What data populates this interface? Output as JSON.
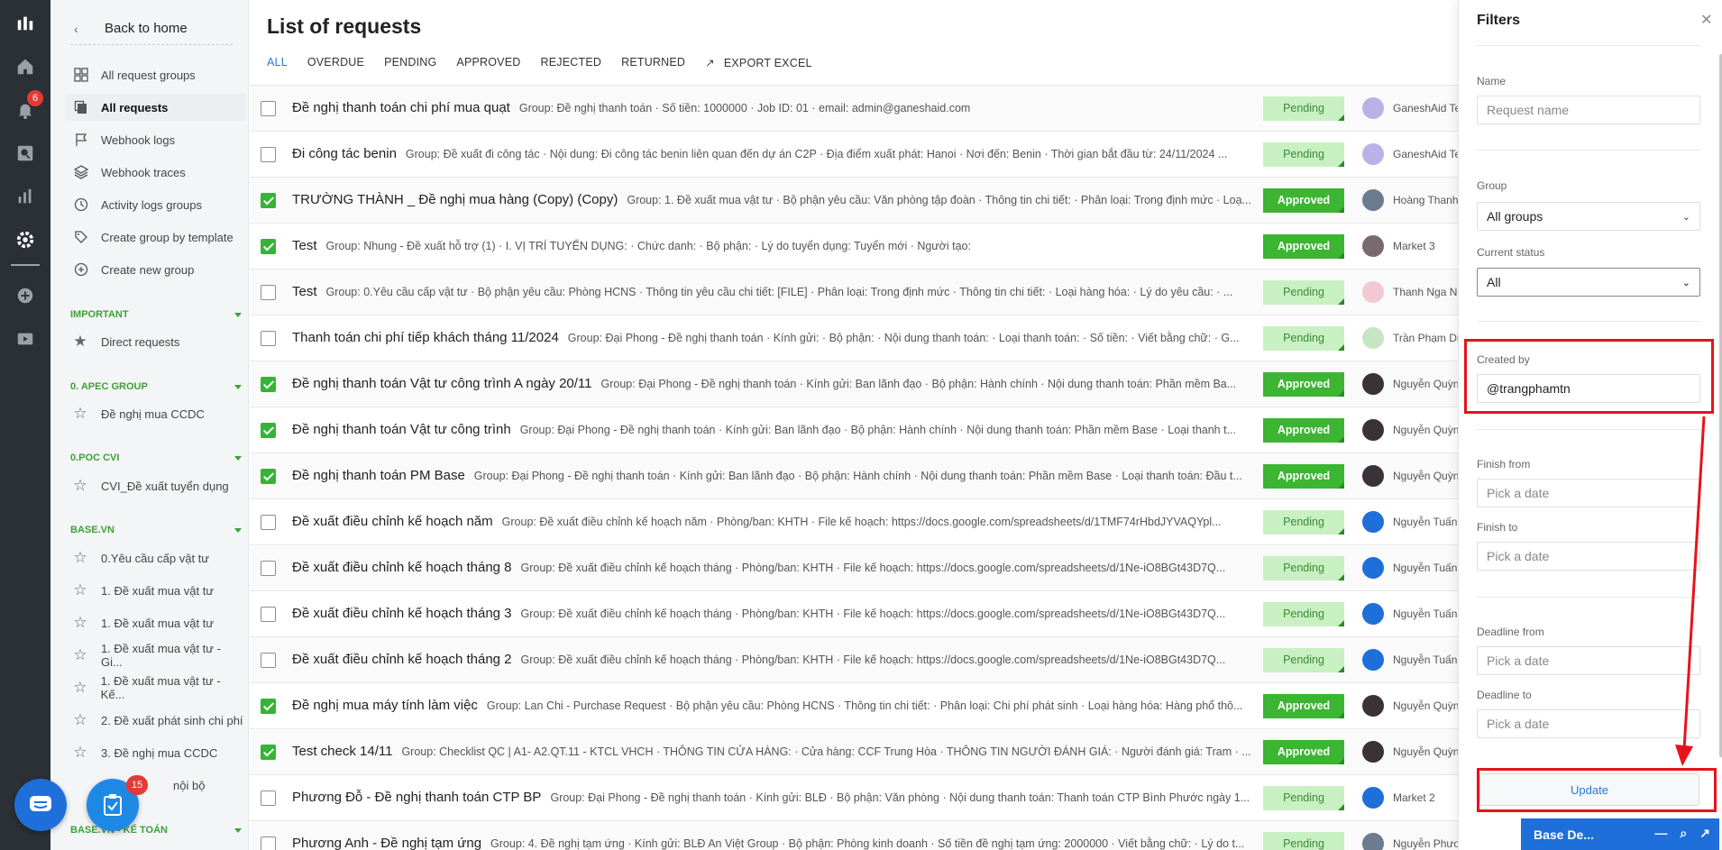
{
  "sidebar": {
    "back_label": "Back to home",
    "notif_badge": "6",
    "items": [
      {
        "label": "All request groups",
        "icon": "grid-icon"
      },
      {
        "label": "All requests",
        "icon": "copy-icon"
      },
      {
        "label": "Webhook logs",
        "icon": "flag-icon"
      },
      {
        "label": "Webhook traces",
        "icon": "layers-icon"
      },
      {
        "label": "Activity logs groups",
        "icon": "clock-icon"
      },
      {
        "label": "Create group by template",
        "icon": "tag-icon"
      },
      {
        "label": "Create new group",
        "icon": "plus-circle-icon"
      }
    ],
    "sections": [
      {
        "title": "IMPORTANT",
        "items": [
          "Direct requests"
        ]
      },
      {
        "title": "0. APEC GROUP",
        "items": [
          "Đề nghị mua CCDC"
        ]
      },
      {
        "title": "0.POC CVI",
        "items": [
          "CVI_Đề xuất tuyển dụng"
        ]
      },
      {
        "title": "BASE.VN",
        "items": [
          "0.Yêu cầu cấp vật tư",
          "1. Đề xuất mua vật tư",
          "1. Đề xuất mua vật tư",
          "1. Đề xuất mua vật tư - Gi...",
          "1. Đề xuất mua vật tư - Kế...",
          "2. Đề xuất phát sinh chi phí",
          "3. Đề nghị mua CCDC",
          "nội bộ"
        ]
      },
      {
        "title": "BASE.VN - KẾ TOÁN",
        "items": []
      }
    ],
    "task_badge": "15"
  },
  "main": {
    "title": "List of requests",
    "tabs": [
      "ALL",
      "OVERDUE",
      "PENDING",
      "APPROVED",
      "REJECTED",
      "RETURNED",
      "EXPORT EXCEL"
    ],
    "rows": [
      {
        "checked": false,
        "title": "Đề nghị thanh toán chi phí mua quạt",
        "desc": "Group: Đề nghị thanh toán · Số tiền: 1000000 · Job ID: 01 · email: admin@ganeshaid.com",
        "status": "Pending",
        "user": "GaneshAid Te",
        "avatar_color": "#b9b2e6"
      },
      {
        "checked": false,
        "title": "Đi công tác benin",
        "desc": "Group: Đề xuất đi công tác · Nội dung: Đi công tác benin liên quan đến dự án C2P · Địa điểm xuất phát: Hanoi · Nơi đến: Benin · Thời gian bắt đầu từ: 24/11/2024 ...",
        "status": "Pending",
        "user": "GaneshAid Te",
        "avatar_color": "#b9b2e6"
      },
      {
        "checked": true,
        "title": "TRƯỜNG THÀNH _ Đề nghị mua hàng (Copy) (Copy)",
        "desc": "Group: 1. Đề xuất mua vật tư · Bộ phận yêu cầu: Văn phòng tập đoàn · Thông tin chi tiết: · Phân loại: Trong định mức · Loạ...",
        "status": "Approved",
        "user": "Hoàng Thanh",
        "avatar_color": "#6b7b90"
      },
      {
        "checked": true,
        "title": "Test",
        "desc": "Group: Nhung - Đề xuất hỗ trợ (1) · I. VỊ TRÍ TUYỂN DỤNG: · Chức danh: · Bộ phận: · Lý do tuyển dụng: Tuyển mới · Người tạo:",
        "status": "Approved",
        "user": "Market 3",
        "avatar_color": "#7a6a70"
      },
      {
        "checked": false,
        "title": "Test",
        "desc": "Group: 0.Yêu cầu cấp vật tư · Bộ phận yêu cầu: Phòng HCNS · Thông tin yêu cầu chi tiết: [FILE] · Phân loại: Trong định mức · Thông tin chi tiết: · Loại hàng hóa: · Lý do yêu cầu: · ...",
        "status": "Pending",
        "user": "Thanh Nga Ng",
        "avatar_color": "#f3c8d5"
      },
      {
        "checked": false,
        "title": "Thanh toán chi phí tiếp khách tháng 11/2024",
        "desc": "Group: Đại Phong - Đề nghị thanh toán · Kính gửi: · Bộ phận: · Nội dung thanh toán: · Loại thanh toán: · Số tiền: · Viết bằng chữ: · G...",
        "status": "Pending",
        "user": "Trần Phạm Di",
        "avatar_color": "#c6e6c3"
      },
      {
        "checked": true,
        "title": "Đề nghị thanh toán Vật tư công trình A ngày 20/11",
        "desc": "Group: Đại Phong - Đề nghị thanh toán · Kính gửi: Ban lãnh đạo · Bộ phận: Hành chính · Nội dung thanh toán: Phần mềm Ba...",
        "status": "Approved",
        "user": "Nguyễn Quỳnh",
        "avatar_color": "#3a3236"
      },
      {
        "checked": true,
        "title": "Đề nghị thanh toán Vật tư công trình",
        "desc": "Group: Đại Phong - Đề nghị thanh toán · Kính gửi: Ban lãnh đạo · Bộ phận: Hành chính · Nội dung thanh toán: Phần mềm Base · Loại thanh t...",
        "status": "Approved",
        "user": "Nguyễn Quỳnh",
        "avatar_color": "#3a3236"
      },
      {
        "checked": true,
        "title": "Đề nghị thanh toán PM Base",
        "desc": "Group: Đại Phong - Đề nghị thanh toán · Kính gửi: Ban lãnh đạo · Bộ phận: Hành chính · Nội dung thanh toán: Phần mềm Base · Loại thanh toán: Đầu t...",
        "status": "Approved",
        "user": "Nguyễn Quỳnh",
        "avatar_color": "#3a3236"
      },
      {
        "checked": false,
        "title": "Đề xuất điều chỉnh kế hoạch năm",
        "desc": "Group: Đề xuất điều chỉnh kế hoạch năm · Phòng/ban: KHTH · File kế hoạch: https://docs.google.com/spreadsheets/d/1TMF74rHbdJYVAQYpl...",
        "status": "Pending",
        "user": "Nguyễn Tuấn",
        "avatar_color": "#1e6fd9"
      },
      {
        "checked": false,
        "title": "Đề xuất điều chỉnh kế hoạch tháng 8",
        "desc": "Group: Đề xuất điều chỉnh kế hoạch tháng · Phòng/ban: KHTH · File kế hoạch: https://docs.google.com/spreadsheets/d/1Ne-iO8BGt43D7Q...",
        "status": "Pending",
        "user": "Nguyễn Tuấn",
        "avatar_color": "#1e6fd9"
      },
      {
        "checked": false,
        "title": "Đề xuất điều chỉnh kế hoạch tháng 3",
        "desc": "Group: Đề xuất điều chỉnh kế hoạch tháng · Phòng/ban: KHTH · File kế hoạch: https://docs.google.com/spreadsheets/d/1Ne-iO8BGt43D7Q...",
        "status": "Pending",
        "user": "Nguyễn Tuấn",
        "avatar_color": "#1e6fd9"
      },
      {
        "checked": false,
        "title": "Đề xuất điều chỉnh kế hoạch tháng 2",
        "desc": "Group: Đề xuất điều chỉnh kế hoạch tháng · Phòng/ban: KHTH · File kế hoạch: https://docs.google.com/spreadsheets/d/1Ne-iO8BGt43D7Q...",
        "status": "Pending",
        "user": "Nguyễn Tuấn",
        "avatar_color": "#1e6fd9"
      },
      {
        "checked": true,
        "title": "Đề nghị mua máy tính làm việc",
        "desc": "Group: Lan Chi - Purchase Request · Bộ phận yêu cầu: Phòng HCNS · Thông tin chi tiết: · Phân loại: Chi phí phát sinh · Loại hàng hóa: Hàng phổ thô...",
        "status": "Approved",
        "user": "Nguyễn Quỳnh",
        "avatar_color": "#3a3236"
      },
      {
        "checked": true,
        "title": "Test check 14/11",
        "desc": "Group: Checklist QC | A1- A2.QT.11 - KTCL VHCH · THÔNG TIN CỬA HÀNG: · Cửa hàng: CCF Trung Hòa · THÔNG TIN NGƯỜI ĐÁNH GIÁ: · Người đánh giá: Tram · ...",
        "status": "Approved",
        "user": "Nguyễn Quỳnh",
        "avatar_color": "#3a3236"
      },
      {
        "checked": false,
        "title": "Phương Đỗ - Đề nghị thanh toán CTP BP",
        "desc": "Group: Đại Phong - Đề nghị thanh toán · Kính gửi: BLĐ · Bộ phận: Văn phòng · Nội dung thanh toán: Thanh toán CTP Bình Phước ngày 1...",
        "status": "Pending",
        "user": "Market 2",
        "avatar_color": "#1e6fd9"
      },
      {
        "checked": false,
        "title": "Phương Anh - Đề nghị tạm ứng",
        "desc": "Group: 4. Đề nghị tạm ứng · Kính gửi: BLĐ An Việt Group · Bộ phận: Phòng kinh doanh · Số tiền đề nghị tạm ứng: 2000000 · Viết bằng chữ: · Lý do t...",
        "status": "Pending",
        "user": "Nguyễn Phươ",
        "avatar_color": "#6b7b90"
      }
    ]
  },
  "filters": {
    "title": "Filters",
    "name_label": "Name",
    "name_placeholder": "Request name",
    "group_label": "Group",
    "group_value": "All groups",
    "status_label": "Current status",
    "status_value": "All",
    "created_label": "Created by",
    "created_value": "@trangphamtn",
    "finish_from_label": "Finish from",
    "finish_to_label": "Finish to",
    "deadline_from_label": "Deadline from",
    "deadline_to_label": "Deadline to",
    "date_placeholder": "Pick a date",
    "update_label": "Update"
  },
  "floating_panel": {
    "title": "Base De..."
  },
  "colors": {
    "accent": "#1e7bd9",
    "approved": "#3bb532",
    "pending_bg": "#c9f0c3",
    "section": "#3aa335",
    "annotation": "#e8121b"
  }
}
